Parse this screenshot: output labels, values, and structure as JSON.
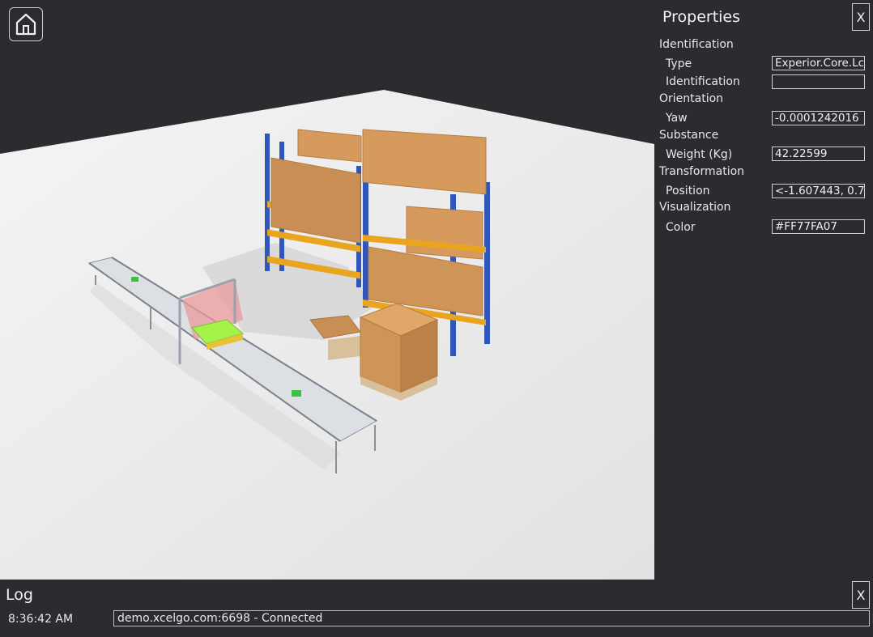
{
  "app": {
    "home_icon": "home-icon",
    "close_label": "X"
  },
  "properties": {
    "title": "Properties",
    "sections": {
      "identification": "Identification",
      "orientation": "Orientation",
      "substance": "Substance",
      "transformation": "Transformation",
      "visualization": "Visualization"
    },
    "fields": {
      "type": {
        "label": "Type",
        "value": "Experior.Core.Lc"
      },
      "identification": {
        "label": "Identification",
        "value": ""
      },
      "yaw": {
        "label": "Yaw",
        "value": "-0.0001242016"
      },
      "weight": {
        "label": "Weight (Kg)",
        "value": "42.22599"
      },
      "position": {
        "label": "Position",
        "value": "<-1.607443, 0.7"
      },
      "color": {
        "label": "Color",
        "value": "#FF77FA07"
      }
    }
  },
  "log": {
    "title": "Log",
    "entries": [
      {
        "time": "8:36:42 AM",
        "message": "demo.xcelgo.com:6698 - Connected"
      }
    ]
  },
  "colors": {
    "background": "#2b2c30",
    "floor": "#e9e9e9",
    "rack_frame": "#2f56b8",
    "rack_beam": "#e9a51f",
    "box": "#d59a5c",
    "pallet_highlight": "#a6f24a",
    "scanner_overlay": "#e99a9a"
  }
}
